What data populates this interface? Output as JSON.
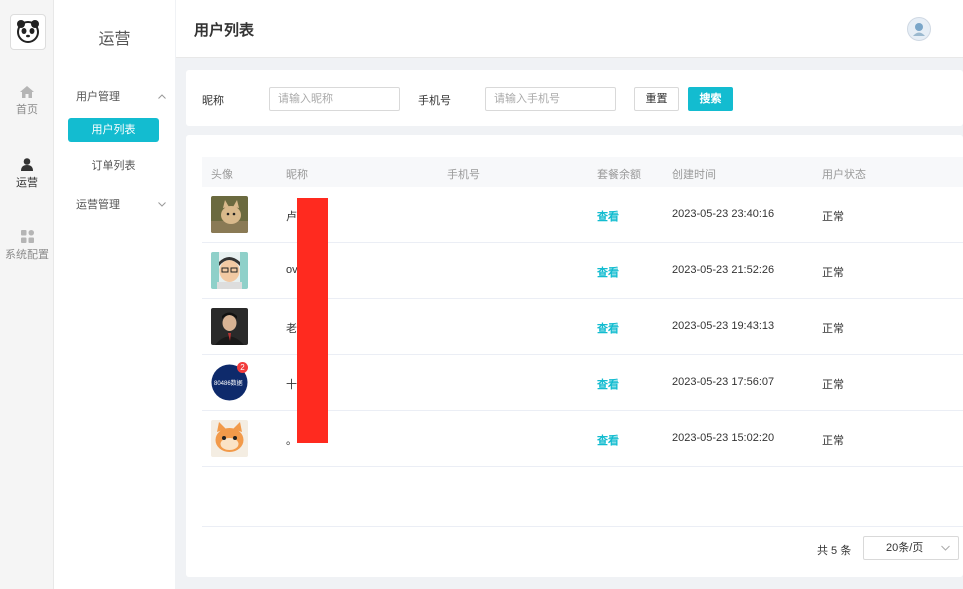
{
  "rail": {
    "items": [
      {
        "label": "首页",
        "icon": "home-icon"
      },
      {
        "label": "运营",
        "icon": "user-icon"
      },
      {
        "label": "系统配置",
        "icon": "grid-icon"
      }
    ]
  },
  "submenu": {
    "title": "运营",
    "group1": "用户管理",
    "item_user_list": "用户列表",
    "item_order_list": "订单列表",
    "group2": "运营管理"
  },
  "header": {
    "title": "用户列表"
  },
  "search": {
    "nickname_label": "昵称",
    "nickname_placeholder": "请输入昵称",
    "phone_label": "手机号",
    "phone_placeholder": "请输入手机号",
    "reset_label": "重置",
    "search_label": "搜索"
  },
  "table": {
    "columns": [
      "头像",
      "昵称",
      "手机号",
      "套餐余额",
      "创建时间",
      "用户状态"
    ],
    "rows": [
      {
        "nickname": "卢",
        "balance": "查看",
        "created": "2023-05-23 23:40:16",
        "status": "正常"
      },
      {
        "nickname": "ov",
        "balance": "查看",
        "created": "2023-05-23 21:52:26",
        "status": "正常"
      },
      {
        "nickname": "老",
        "balance": "查看",
        "created": "2023-05-23 19:43:13",
        "status": "正常"
      },
      {
        "nickname": "十",
        "balance": "查看",
        "created": "2023-05-23 17:56:07",
        "status": "正常"
      },
      {
        "nickname": "。",
        "balance": "查看",
        "created": "2023-05-23 15:02:20",
        "status": "正常"
      }
    ],
    "avatar_badge": "2",
    "avatar_logo_text": "80486数据"
  },
  "pagination": {
    "total": "共 5 条",
    "page_size": "20条/页"
  },
  "colors": {
    "accent": "#13bcd0",
    "redaction": "#ff2a1f"
  }
}
